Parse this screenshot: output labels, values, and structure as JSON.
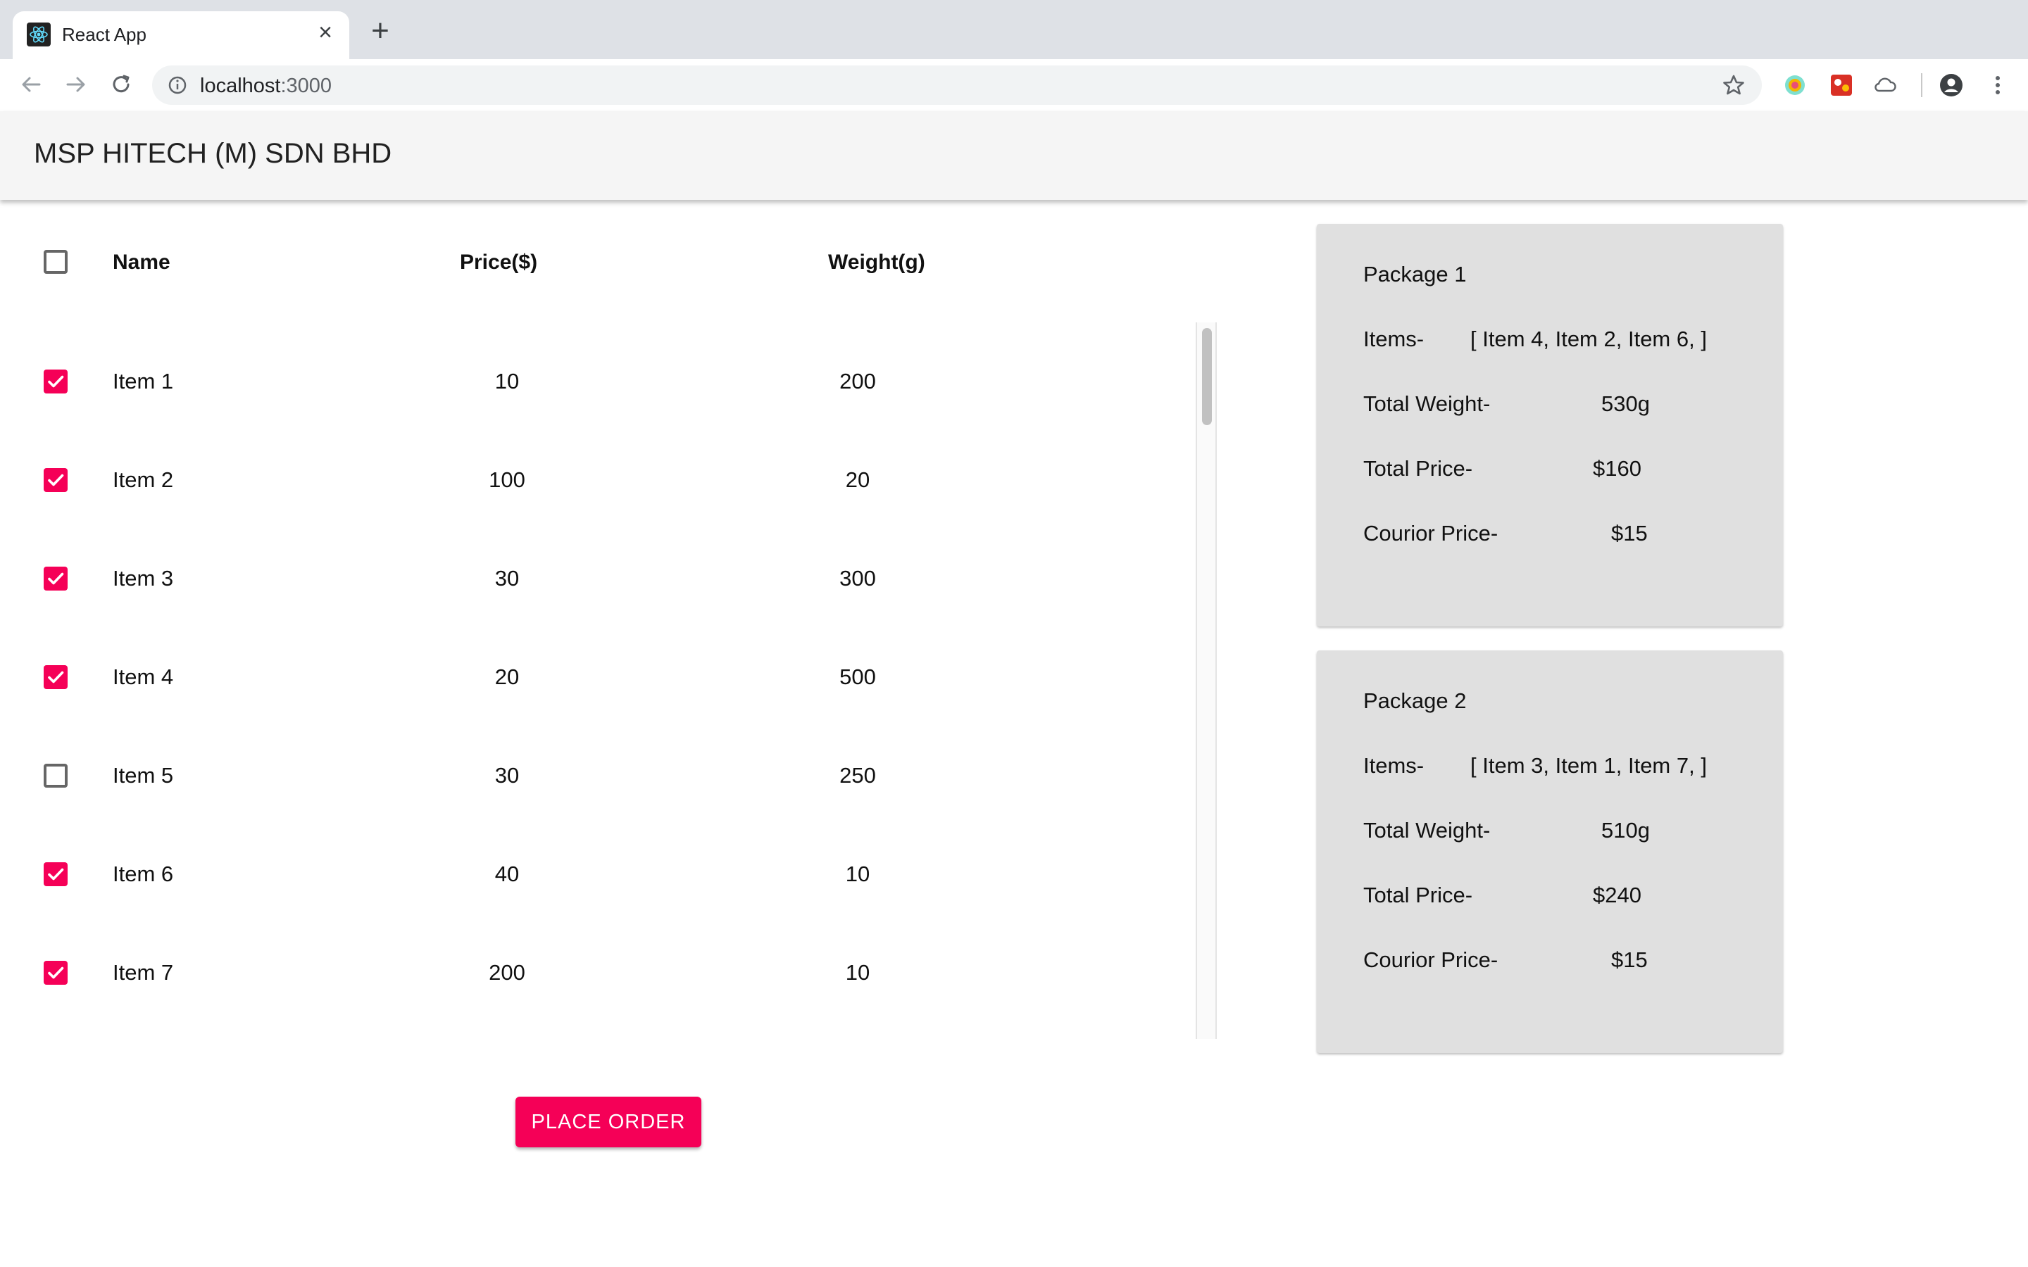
{
  "browser": {
    "tab_title": "React App",
    "tab_close": "×",
    "new_tab": "+",
    "url_host": "localhost",
    "url_port": ":3000"
  },
  "app": {
    "title": "MSP HITECH (M) SDN BHD"
  },
  "table": {
    "headers": {
      "name": "Name",
      "price": "Price($)",
      "weight": "Weight(g)"
    },
    "select_all_checked": false,
    "rows": [
      {
        "checked": true,
        "name": "Item 1",
        "price": "10",
        "weight": "200"
      },
      {
        "checked": true,
        "name": "Item 2",
        "price": "100",
        "weight": "20"
      },
      {
        "checked": true,
        "name": "Item 3",
        "price": "30",
        "weight": "300"
      },
      {
        "checked": true,
        "name": "Item 4",
        "price": "20",
        "weight": "500"
      },
      {
        "checked": false,
        "name": "Item 5",
        "price": "30",
        "weight": "250"
      },
      {
        "checked": true,
        "name": "Item 6",
        "price": "40",
        "weight": "10"
      },
      {
        "checked": true,
        "name": "Item 7",
        "price": "200",
        "weight": "10"
      }
    ]
  },
  "place_order_label": "PLACE ORDER",
  "packages": [
    {
      "title": "Package 1",
      "items_label": "Items-",
      "items_value": "[ Item 4, Item 2, Item 6, ]",
      "weight_label": "Total Weight-",
      "weight_value": "530g",
      "price_label": "Total Price-",
      "price_value": "$160",
      "courier_label": "Courior Price-",
      "courier_value": "$15"
    },
    {
      "title": "Package 2",
      "items_label": "Items-",
      "items_value": "[ Item 3, Item 1, Item 7, ]",
      "weight_label": "Total Weight-",
      "weight_value": "510g",
      "price_label": "Total Price-",
      "price_value": "$240",
      "courier_label": "Courior Price-",
      "courier_value": "$15"
    }
  ],
  "colors": {
    "accent": "#f50057",
    "card": "#e0e0e0",
    "appbar": "#f5f5f5"
  }
}
